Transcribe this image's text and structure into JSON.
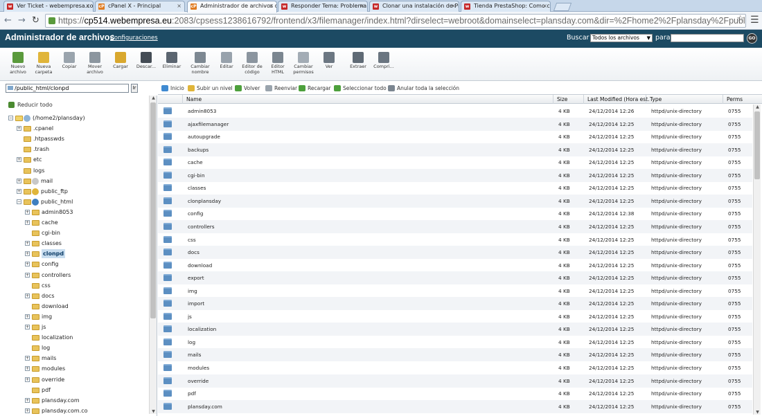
{
  "browser": {
    "tabs": [
      {
        "label": "Ver Ticket - webempresa.co",
        "icon": "webempresa-favicon",
        "color": "#c62828"
      },
      {
        "label": "cPanel X - Principal",
        "icon": "cpanel-favicon",
        "color": "#e07b20"
      },
      {
        "label": "Administrador de archivos de",
        "icon": "cpanel-favicon",
        "color": "#e07b20"
      },
      {
        "label": "Responder Tema: Problema",
        "icon": "webempresa-favicon",
        "color": "#c62828"
      },
      {
        "label": "Clonar una instalación de Pr",
        "icon": "webempresa-favicon",
        "color": "#c62828"
      },
      {
        "label": "Tienda PrestaShop: Como c",
        "icon": "webempresa-favicon",
        "color": "#c62828"
      }
    ],
    "url_host": "cp514.webempresa.eu",
    "url_rest": ":2083/cpsess1238616792/frontend/x3/filemanager/index.html?dirselect=webroot&domainselect=plansday.com&dir=%2Fhome2%2Fplansday%2Fpublic_html&showhidde",
    "url_scheme": "https://"
  },
  "header": {
    "title": "Administrador de archivos",
    "config_link": "Configuraciones",
    "search_label": "Buscar",
    "search_scope": "Todos los archivos",
    "for_label": "para",
    "go_label": "GO"
  },
  "toolbar": [
    {
      "label": "Nuevo archivo",
      "icon": "new-file-icon",
      "color": "#5a9a3c"
    },
    {
      "label": "Nueva carpeta",
      "icon": "new-folder-icon",
      "color": "#e0b53a"
    },
    {
      "label": "Copiar",
      "icon": "copy-icon",
      "color": "#9aa4ad"
    },
    {
      "label": "Mover archivo",
      "icon": "move-icon",
      "color": "#8c969f"
    },
    {
      "label": "Cargar",
      "icon": "upload-icon",
      "color": "#d9a82e"
    },
    {
      "label": "Descar...",
      "icon": "download-icon",
      "color": "#444c55"
    },
    {
      "label": "Eliminar",
      "icon": "delete-icon",
      "color": "#5b6570"
    },
    {
      "label": "Cambiar nombre",
      "icon": "rename-icon",
      "color": "#7d8892"
    },
    {
      "label": "Editar",
      "icon": "edit-icon",
      "color": "#98a2ac"
    },
    {
      "label": "Editor de código",
      "icon": "code-editor-icon",
      "color": "#8b959f"
    },
    {
      "label": "Editor HTML",
      "icon": "html-editor-icon",
      "color": "#7b8690"
    },
    {
      "label": "Cambiar permisos",
      "icon": "permissions-icon",
      "color": "#a3acb5"
    },
    {
      "label": "Ver",
      "icon": "view-icon",
      "color": "#6c7782"
    },
    {
      "label": "Extraer",
      "icon": "extract-icon",
      "color": "#5f6a75"
    },
    {
      "label": "Compri...",
      "icon": "compress-icon",
      "color": "#6a7580"
    }
  ],
  "path": {
    "value": "/public_html/clonpd",
    "go_label": "Ir"
  },
  "actions": [
    {
      "label": "Inicio",
      "icon": "home-icon",
      "color": "#3f8ad1"
    },
    {
      "label": "Subir un nivel",
      "icon": "up-level-icon",
      "color": "#e0b53a"
    },
    {
      "label": "Volver",
      "icon": "back-icon",
      "color": "#4da03c"
    },
    {
      "label": "Reenviar",
      "icon": "forward-icon",
      "color": "#9aa4ad"
    },
    {
      "label": "Recargar",
      "icon": "reload-icon",
      "color": "#4da03c"
    },
    {
      "label": "Seleccionar todo",
      "icon": "select-all-icon",
      "color": "#4da03c"
    },
    {
      "label": "Anular toda la selección",
      "icon": "unselect-all-icon",
      "color": "#7b8690"
    }
  ],
  "tree": {
    "collapse_label": "Reducir todo",
    "nodes": [
      {
        "label": "(/home2/plansday)",
        "level": 0,
        "toggle": "−",
        "special": "home"
      },
      {
        "label": ".cpanel",
        "level": 1,
        "toggle": "+"
      },
      {
        "label": ".htpasswds",
        "level": 1,
        "toggle": ""
      },
      {
        "label": ".trash",
        "level": 1,
        "toggle": ""
      },
      {
        "label": "etc",
        "level": 1,
        "toggle": "+"
      },
      {
        "label": "logs",
        "level": 1,
        "toggle": ""
      },
      {
        "label": "mail",
        "level": 1,
        "toggle": "+",
        "special": "mail"
      },
      {
        "label": "public_ftp",
        "level": 1,
        "toggle": "+",
        "special": "ftp"
      },
      {
        "label": "public_html",
        "level": 1,
        "toggle": "−",
        "special": "web"
      },
      {
        "label": "admin8053",
        "level": 2,
        "toggle": "+"
      },
      {
        "label": "cache",
        "level": 2,
        "toggle": "+"
      },
      {
        "label": "cgi-bin",
        "level": 2,
        "toggle": ""
      },
      {
        "label": "classes",
        "level": 2,
        "toggle": "+"
      },
      {
        "label": "clonpd",
        "level": 2,
        "toggle": "+",
        "selected": true
      },
      {
        "label": "config",
        "level": 2,
        "toggle": "+"
      },
      {
        "label": "controllers",
        "level": 2,
        "toggle": "+"
      },
      {
        "label": "css",
        "level": 2,
        "toggle": ""
      },
      {
        "label": "docs",
        "level": 2,
        "toggle": "+"
      },
      {
        "label": "download",
        "level": 2,
        "toggle": ""
      },
      {
        "label": "img",
        "level": 2,
        "toggle": "+"
      },
      {
        "label": "js",
        "level": 2,
        "toggle": "+"
      },
      {
        "label": "localization",
        "level": 2,
        "toggle": ""
      },
      {
        "label": "log",
        "level": 2,
        "toggle": ""
      },
      {
        "label": "mails",
        "level": 2,
        "toggle": "+"
      },
      {
        "label": "modules",
        "level": 2,
        "toggle": "+"
      },
      {
        "label": "override",
        "level": 2,
        "toggle": "+"
      },
      {
        "label": "pdf",
        "level": 2,
        "toggle": ""
      },
      {
        "label": "plansday.com",
        "level": 2,
        "toggle": "+"
      },
      {
        "label": "plansday.com.co",
        "level": 2,
        "toggle": "+"
      }
    ]
  },
  "table": {
    "headers": [
      "Name",
      "Size",
      "Last Modified (Hora est. c",
      "Type",
      "Perms"
    ],
    "rows": [
      [
        "admin8053",
        "4 KB",
        "24/12/2014 12:26",
        "httpd/unix-directory",
        "0755"
      ],
      [
        "ajaxfilemanager",
        "4 KB",
        "24/12/2014 12:25",
        "httpd/unix-directory",
        "0755"
      ],
      [
        "autoupgrade",
        "4 KB",
        "24/12/2014 12:25",
        "httpd/unix-directory",
        "0755"
      ],
      [
        "backups",
        "4 KB",
        "24/12/2014 12:25",
        "httpd/unix-directory",
        "0755"
      ],
      [
        "cache",
        "4 KB",
        "24/12/2014 12:25",
        "httpd/unix-directory",
        "0755"
      ],
      [
        "cgi-bin",
        "4 KB",
        "24/12/2014 12:25",
        "httpd/unix-directory",
        "0755"
      ],
      [
        "classes",
        "4 KB",
        "24/12/2014 12:25",
        "httpd/unix-directory",
        "0755"
      ],
      [
        "clonplansday",
        "4 KB",
        "24/12/2014 12:25",
        "httpd/unix-directory",
        "0755"
      ],
      [
        "config",
        "4 KB",
        "24/12/2014 12:38",
        "httpd/unix-directory",
        "0755"
      ],
      [
        "controllers",
        "4 KB",
        "24/12/2014 12:25",
        "httpd/unix-directory",
        "0755"
      ],
      [
        "css",
        "4 KB",
        "24/12/2014 12:25",
        "httpd/unix-directory",
        "0755"
      ],
      [
        "docs",
        "4 KB",
        "24/12/2014 12:25",
        "httpd/unix-directory",
        "0755"
      ],
      [
        "download",
        "4 KB",
        "24/12/2014 12:25",
        "httpd/unix-directory",
        "0755"
      ],
      [
        "export",
        "4 KB",
        "24/12/2014 12:25",
        "httpd/unix-directory",
        "0755"
      ],
      [
        "img",
        "4 KB",
        "24/12/2014 12:25",
        "httpd/unix-directory",
        "0755"
      ],
      [
        "import",
        "4 KB",
        "24/12/2014 12:25",
        "httpd/unix-directory",
        "0755"
      ],
      [
        "js",
        "4 KB",
        "24/12/2014 12:25",
        "httpd/unix-directory",
        "0755"
      ],
      [
        "localization",
        "4 KB",
        "24/12/2014 12:25",
        "httpd/unix-directory",
        "0755"
      ],
      [
        "log",
        "4 KB",
        "24/12/2014 12:25",
        "httpd/unix-directory",
        "0755"
      ],
      [
        "mails",
        "4 KB",
        "24/12/2014 12:25",
        "httpd/unix-directory",
        "0755"
      ],
      [
        "modules",
        "4 KB",
        "24/12/2014 12:25",
        "httpd/unix-directory",
        "0755"
      ],
      [
        "override",
        "4 KB",
        "24/12/2014 12:25",
        "httpd/unix-directory",
        "0755"
      ],
      [
        "pdf",
        "4 KB",
        "24/12/2014 12:25",
        "httpd/unix-directory",
        "0755"
      ],
      [
        "plansday.com",
        "4 KB",
        "24/12/2014 12:25",
        "httpd/unix-directory",
        "0755"
      ]
    ]
  },
  "colors": {
    "header_bg": "#1c4a63",
    "folder_blue": "#5c8fc2",
    "tree_folder": "#e8c35b",
    "selection": "#c8ddef"
  }
}
